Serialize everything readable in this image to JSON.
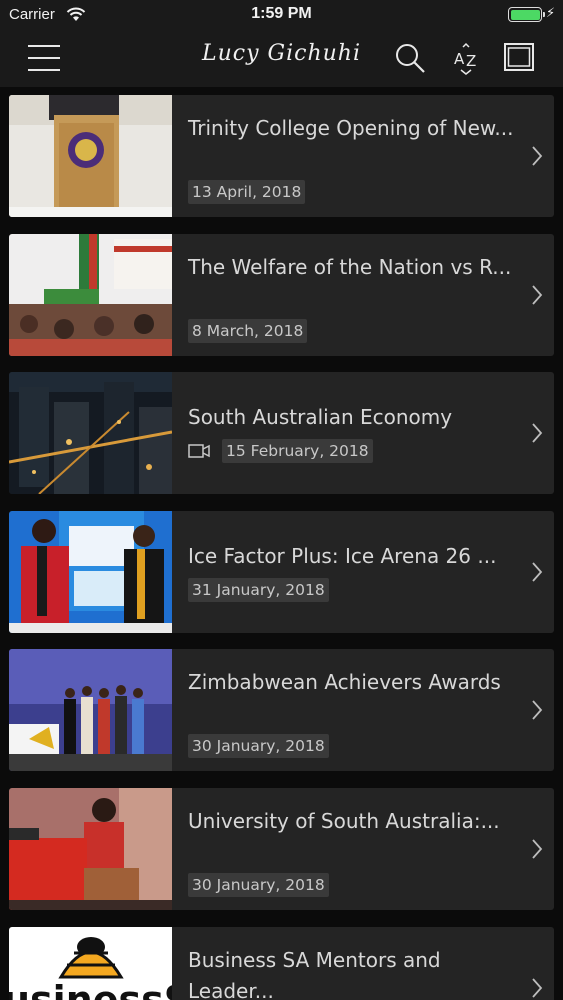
{
  "status_bar": {
    "carrier": "Carrier",
    "time": "1:59 PM"
  },
  "nav": {
    "title": "Lucy Gichuhi",
    "icons": [
      "menu-icon",
      "search-icon",
      "sort-az-icon",
      "layout-icon"
    ]
  },
  "articles": [
    {
      "title": "Trinity College Opening of New...",
      "date": "13 April, 2018",
      "has_video": false
    },
    {
      "title": "The Welfare of the Nation vs R...",
      "date": "8 March, 2018",
      "has_video": false
    },
    {
      "title": "South Australian Economy",
      "date": "15 February, 2018",
      "has_video": true
    },
    {
      "title": "Ice Factor Plus: Ice Arena 26 ...",
      "date": "31 January, 2018",
      "has_video": false
    },
    {
      "title": "Zimbabwean Achievers Awards",
      "date": "30 January, 2018",
      "has_video": false
    },
    {
      "title": "University of South Australia:...",
      "date": "30 January, 2018",
      "has_video": false
    },
    {
      "title": "Business SA Mentors and Leader...",
      "date": "",
      "has_video": false
    }
  ],
  "thumb_text": {
    "business_logo": "usinessS"
  },
  "colors": {
    "background": "#0b0b0b",
    "card": "#242424",
    "battery": "#4cd964",
    "date_badge": "#3a3a3a"
  }
}
